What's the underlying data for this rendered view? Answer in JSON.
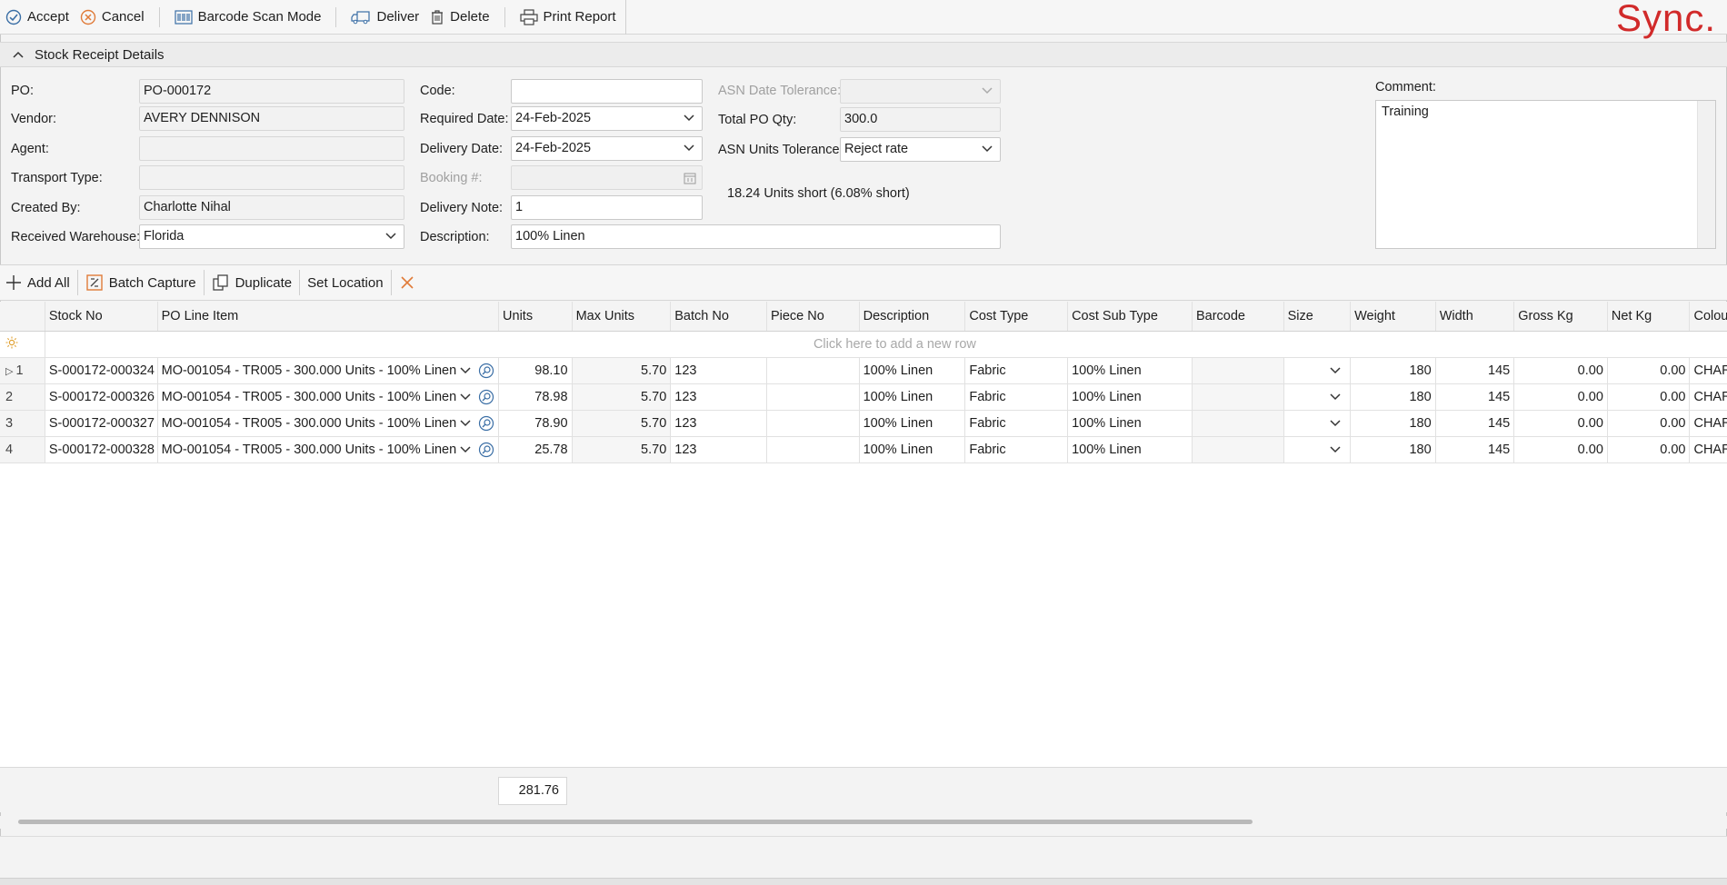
{
  "toolbar": {
    "accept": "Accept",
    "cancel": "Cancel",
    "barcode_scan_mode": "Barcode Scan Mode",
    "deliver": "Deliver",
    "delete": "Delete",
    "print_report": "Print Report",
    "logo": "Sync."
  },
  "section": {
    "title": "Stock Receipt Details"
  },
  "form": {
    "po_label": "PO:",
    "po_value": "PO-000172",
    "vendor_label": "Vendor:",
    "vendor_value": "AVERY DENNISON",
    "agent_label": "Agent:",
    "agent_value": "",
    "transport_label": "Transport Type:",
    "transport_value": "",
    "created_by_label": "Created By:",
    "created_by_value": "Charlotte Nihal",
    "warehouse_label": "Received Warehouse:",
    "warehouse_value": "Florida",
    "code_label": "Code:",
    "code_value": "",
    "required_date_label": "Required Date:",
    "required_date_value": "24-Feb-2025",
    "delivery_date_label": "Delivery Date:",
    "delivery_date_value": "24-Feb-2025",
    "booking_label": "Booking #:",
    "booking_value": "",
    "delivery_note_label": "Delivery Note:",
    "delivery_note_value": "1",
    "description_label": "Description:",
    "description_value": "100% Linen",
    "asn_date_tol_label": "ASN Date Tolerance:",
    "asn_date_tol_value": "",
    "total_po_qty_label": "Total PO Qty:",
    "total_po_qty_value": "300.0",
    "asn_units_tol_label": "ASN Units Tolerance:",
    "asn_units_tol_value": "Reject rate",
    "units_short_text": "18.24 Units short (6.08% short)",
    "comment_label": "Comment:",
    "comment_value": "Training"
  },
  "gridbar": {
    "add_all": "Add All",
    "batch_capture": "Batch Capture",
    "duplicate": "Duplicate",
    "set_location": "Set Location"
  },
  "grid": {
    "columns": [
      "Stock No",
      "PO Line Item",
      "Units",
      "Max Units",
      "Batch No",
      "Piece No",
      "Description",
      "Cost Type",
      "Cost Sub Type",
      "Barcode",
      "Size",
      "Weight",
      "Width",
      "Gross Kg",
      "Net Kg",
      "Colour"
    ],
    "new_row_hint": "Click here to add a new row",
    "rows": [
      {
        "index": "1",
        "stock_no": "S-000172-000324",
        "po_line": "MO-001054 - TR005 - 300.000 Units - 100% Linen",
        "units": "98.10",
        "max_units": "5.70",
        "batch_no": "123",
        "piece_no": "",
        "description": "100% Linen",
        "cost_type": "Fabric",
        "cost_sub_type": "100% Linen",
        "barcode": "",
        "size": "",
        "weight": "180",
        "width": "145",
        "gross_kg": "0.00",
        "net_kg": "0.00",
        "colour": "CHARCO"
      },
      {
        "index": "2",
        "stock_no": "S-000172-000326",
        "po_line": "MO-001054 - TR005 - 300.000 Units - 100% Linen",
        "units": "78.98",
        "max_units": "5.70",
        "batch_no": "123",
        "piece_no": "",
        "description": "100% Linen",
        "cost_type": "Fabric",
        "cost_sub_type": "100% Linen",
        "barcode": "",
        "size": "",
        "weight": "180",
        "width": "145",
        "gross_kg": "0.00",
        "net_kg": "0.00",
        "colour": "CHARCO"
      },
      {
        "index": "3",
        "stock_no": "S-000172-000327",
        "po_line": "MO-001054 - TR005 - 300.000 Units - 100% Linen",
        "units": "78.90",
        "max_units": "5.70",
        "batch_no": "123",
        "piece_no": "",
        "description": "100% Linen",
        "cost_type": "Fabric",
        "cost_sub_type": "100% Linen",
        "barcode": "",
        "size": "",
        "weight": "180",
        "width": "145",
        "gross_kg": "0.00",
        "net_kg": "0.00",
        "colour": "CHARCO"
      },
      {
        "index": "4",
        "stock_no": "S-000172-000328",
        "po_line": "MO-001054 - TR005 - 300.000 Units - 100% Linen",
        "units": "25.78",
        "max_units": "5.70",
        "batch_no": "123",
        "piece_no": "",
        "description": "100% Linen",
        "cost_type": "Fabric",
        "cost_sub_type": "100% Linen",
        "barcode": "",
        "size": "",
        "weight": "180",
        "width": "145",
        "gross_kg": "0.00",
        "net_kg": "0.00",
        "colour": "CHARCO"
      }
    ],
    "units_total": "281.76"
  },
  "colors": {
    "brand": "#d12a2a",
    "accent_icon": "#e07b39",
    "icon_blue": "#3a6ea5"
  }
}
